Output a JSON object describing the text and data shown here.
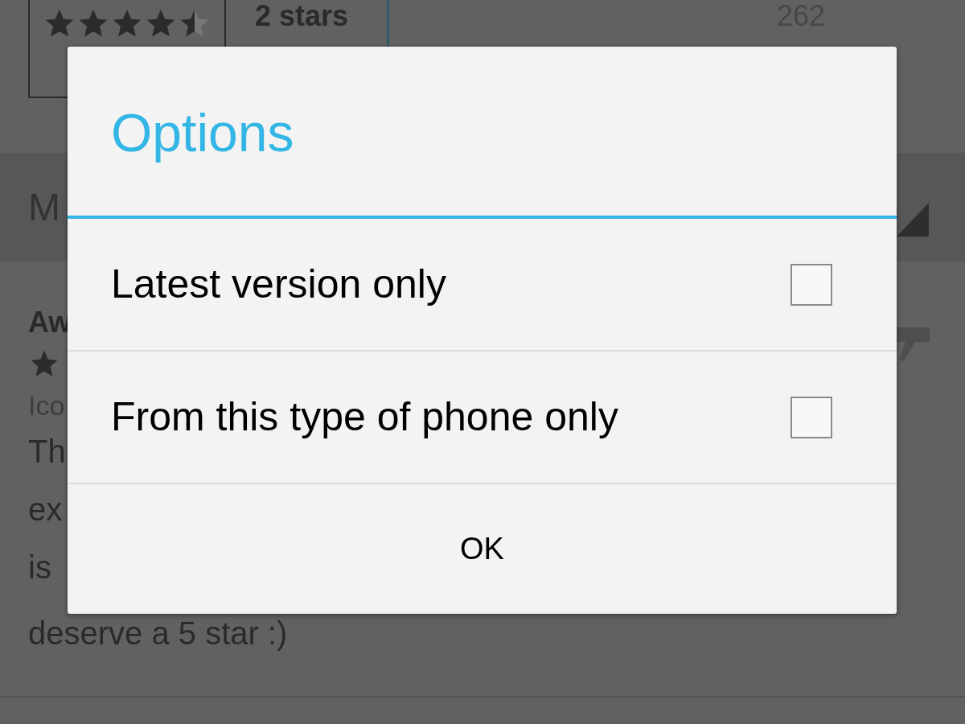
{
  "background": {
    "rating": {
      "stars": 4.5
    },
    "histogram_row": {
      "label": "2 stars",
      "count": "262"
    },
    "sort_bar": {
      "label": "M"
    },
    "review": {
      "title": "Aw",
      "author": "Ico",
      "body_lines": [
        "Th",
        "ex",
        "is",
        "deserve a 5 star :)"
      ]
    }
  },
  "dialog": {
    "title": "Options",
    "options": [
      {
        "label": "Latest version only",
        "checked": false
      },
      {
        "label": "From this type of phone only",
        "checked": false
      }
    ],
    "button": "OK"
  }
}
